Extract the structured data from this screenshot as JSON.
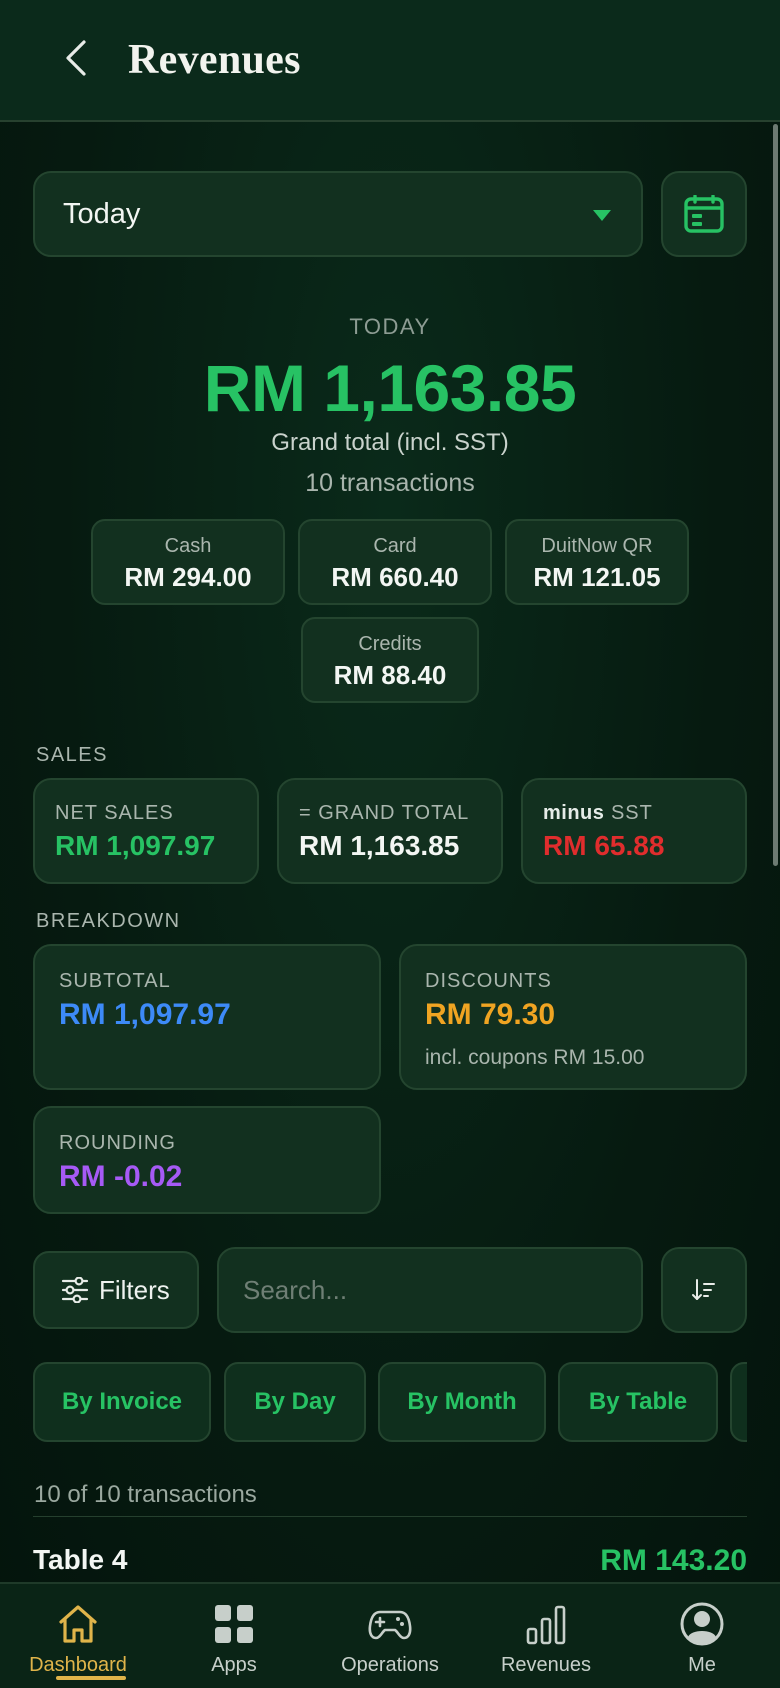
{
  "header": {
    "title": "Revenues",
    "back_icon": "chevron-left-icon"
  },
  "period": {
    "selected": "Today",
    "calendar_icon": "calendar-icon"
  },
  "summary": {
    "period_label": "TODAY",
    "grand_total": "RM 1,163.85",
    "grand_total_caption": "Grand total (incl. SST)",
    "transactions": "10 transactions"
  },
  "payments": [
    {
      "label": "Cash",
      "amount": "RM 294.00"
    },
    {
      "label": "Card",
      "amount": "RM 660.40"
    },
    {
      "label": "DuitNow QR",
      "amount": "RM 121.05"
    },
    {
      "label": "Credits",
      "amount": "RM 88.40"
    }
  ],
  "sales": {
    "section_label": "SALES",
    "net_sales": {
      "label": "NET SALES",
      "amount": "RM 1,097.97"
    },
    "grand_total": {
      "prefix": "=",
      "label": "GRAND TOTAL",
      "amount": "RM 1,163.85"
    },
    "sst": {
      "prefix": "minus",
      "label": "SST",
      "amount": "RM 65.88"
    }
  },
  "breakdown": {
    "section_label": "BREAKDOWN",
    "subtotal": {
      "label": "SUBTOTAL",
      "amount": "RM 1,097.97"
    },
    "discounts": {
      "label": "DISCOUNTS",
      "amount": "RM 79.30",
      "note": "incl. coupons RM 15.00"
    },
    "rounding": {
      "label": "ROUNDING",
      "amount": "RM -0.02"
    }
  },
  "toolbar": {
    "filters_label": "Filters",
    "search_placeholder": "Search..."
  },
  "chips": [
    "By Invoice",
    "By Day",
    "By Month",
    "By Table",
    ""
  ],
  "list": {
    "summary": "10 of 10 transactions",
    "rows": [
      {
        "name": "Table 4",
        "amount": "RM 143.20"
      }
    ]
  },
  "nav": [
    {
      "label": "Dashboard",
      "icon": "home-icon",
      "active": true
    },
    {
      "label": "Apps",
      "icon": "grid-icon",
      "active": false
    },
    {
      "label": "Operations",
      "icon": "gamepad-icon",
      "active": false
    },
    {
      "label": "Revenues",
      "icon": "bar-chart-icon",
      "active": false
    },
    {
      "label": "Me",
      "icon": "user-circle-icon",
      "active": false
    }
  ],
  "colors": {
    "accent_green": "#27c264",
    "blue": "#3d8af7",
    "orange": "#f0a422",
    "red": "#e02d2d",
    "purple": "#a65af5",
    "gold": "#e0b44a"
  }
}
